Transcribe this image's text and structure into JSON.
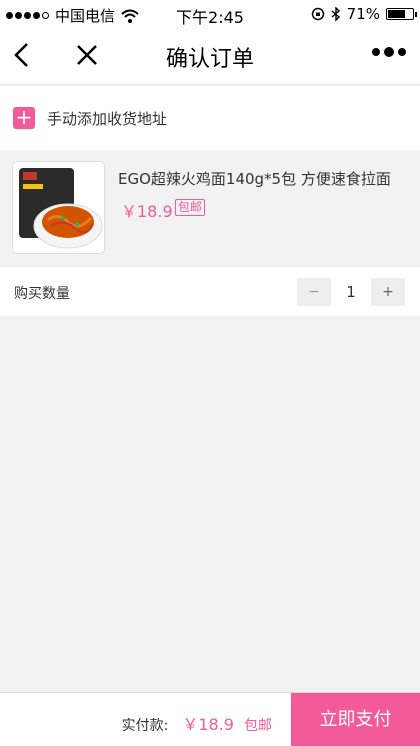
{
  "status_bar": {
    "carrier": "中国电信",
    "time": "下午2:45",
    "battery": "71%",
    "battery_level": 0.71,
    "signal_bars_filled": 4
  },
  "nav": {
    "title": "确认订单",
    "back_icon": "chevron-left-icon",
    "close_icon": "close-icon",
    "more_icon": "more-dots-icon"
  },
  "address": {
    "add_label": "手动添加收货地址",
    "icon": "plus-icon"
  },
  "product": {
    "name": "EGO超辣火鸡面140g*5包 方便速食拉面",
    "price": "￥18.9",
    "shipping_tag": "包邮"
  },
  "quantity": {
    "label": "购买数量",
    "minus": "−",
    "value": "1",
    "plus": "+"
  },
  "footer": {
    "total_label": "实付款:",
    "total_amount": "￥18.9",
    "shipping": "包邮",
    "pay_button": "立即支付"
  },
  "colors": {
    "accent": "#f35a98",
    "background": "#f2f2f2"
  }
}
